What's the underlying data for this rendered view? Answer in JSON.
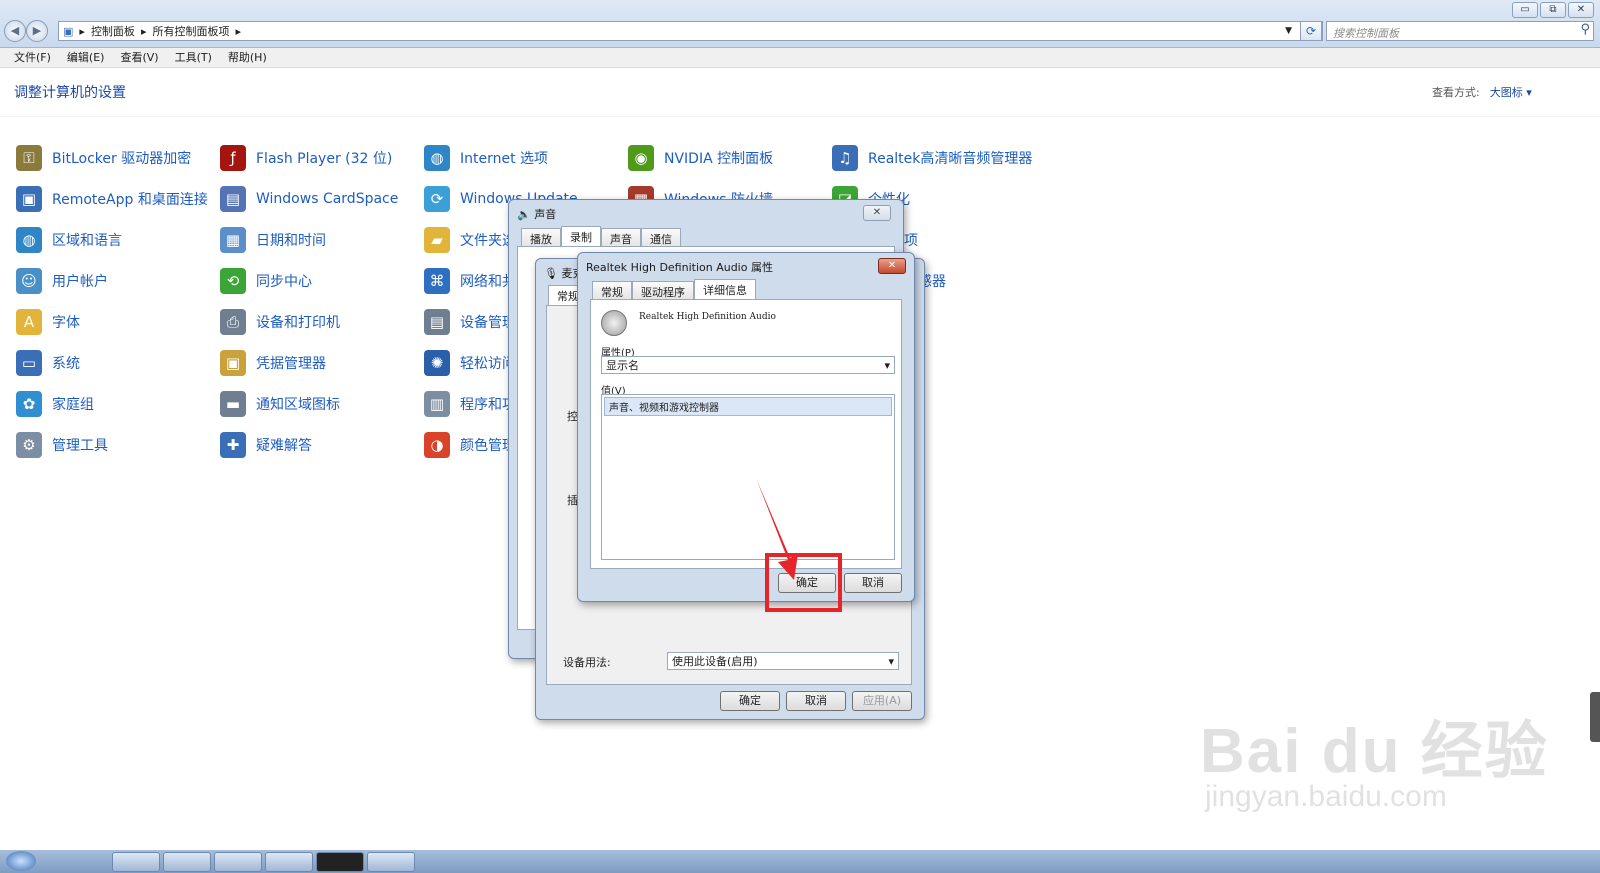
{
  "window": {
    "min": "▭",
    "max": "⧉",
    "close": "✕"
  },
  "address": {
    "crumbs": [
      "控制面板",
      "所有控制面板项"
    ],
    "search_placeholder": "搜索控制面板"
  },
  "menu": [
    "文件(F)",
    "编辑(E)",
    "查看(V)",
    "工具(T)",
    "帮助(H)"
  ],
  "header": {
    "title": "调整计算机的设置",
    "view_label": "查看方式:",
    "view_value": "大图标 ▾"
  },
  "items": {
    "col1": [
      {
        "label": "BitLocker 驱动器加密",
        "icon": "key-icon",
        "color": "#8a7a3c"
      },
      {
        "label": "RemoteApp 和桌面连接",
        "icon": "remote-desktop-icon",
        "color": "#3a6fb8"
      },
      {
        "label": "区域和语言",
        "icon": "globe-icon",
        "color": "#2e86c7"
      },
      {
        "label": "用户帐户",
        "icon": "users-icon",
        "color": "#4a90c8"
      },
      {
        "label": "字体",
        "icon": "font-icon",
        "color": "#e2b43a"
      },
      {
        "label": "系统",
        "icon": "computer-icon",
        "color": "#3a6fb8"
      },
      {
        "label": "家庭组",
        "icon": "homegroup-icon",
        "color": "#2f8fd0"
      },
      {
        "label": "管理工具",
        "icon": "tools-icon",
        "color": "#7b8ea3"
      }
    ],
    "col2": [
      {
        "label": "Flash Player (32 位)",
        "icon": "flash-icon",
        "color": "#a3150e"
      },
      {
        "label": "Windows CardSpace",
        "icon": "cardspace-icon",
        "color": "#5673b4"
      },
      {
        "label": "日期和时间",
        "icon": "calendar-icon",
        "color": "#5c8fc9"
      },
      {
        "label": "同步中心",
        "icon": "sync-icon",
        "color": "#3ca537"
      },
      {
        "label": "设备和打印机",
        "icon": "printer-icon",
        "color": "#6f7f91"
      },
      {
        "label": "凭据管理器",
        "icon": "vault-icon",
        "color": "#c9a23e"
      },
      {
        "label": "通知区域图标",
        "icon": "tray-icon",
        "color": "#6f7f91"
      },
      {
        "label": "疑难解答",
        "icon": "troubleshoot-icon",
        "color": "#3a6fb8"
      }
    ],
    "col3": [
      {
        "label": "Internet 选项",
        "icon": "internet-icon",
        "color": "#2e86c7"
      },
      {
        "label": "Windows Update",
        "icon": "update-icon",
        "color": "#3ca0d8"
      },
      {
        "label": "文件夹选",
        "icon": "folder-icon",
        "color": "#e2b43a"
      },
      {
        "label": "网络和共",
        "icon": "network-icon",
        "color": "#2e6fc0"
      },
      {
        "label": "设备管理",
        "icon": "device-manager-icon",
        "color": "#6f7f91"
      },
      {
        "label": "轻松访问",
        "icon": "accessibility-icon",
        "color": "#2a5faa"
      },
      {
        "label": "程序和功",
        "icon": "programs-icon",
        "color": "#7b8ea3"
      },
      {
        "label": "颜色管理",
        "icon": "color-icon",
        "color": "#d9432a"
      }
    ],
    "col4": [
      {
        "label": "NVIDIA 控制面板",
        "icon": "nvidia-icon",
        "color": "#4f9a1a"
      },
      {
        "label": "Windows 防火墙",
        "icon": "firewall-icon",
        "color": "#a33a2a"
      }
    ],
    "col5": [
      {
        "label": "Realtek高清晰音频管理器",
        "icon": "audio-manager-icon",
        "color": "#3a6fb8"
      },
      {
        "label": "个性化",
        "icon": "personalize-icon",
        "color": "#3ca537"
      },
      {
        "label": "选项"
      },
      {
        "label": "也传感器"
      }
    ]
  },
  "sound_dialog": {
    "title": "声音",
    "tabs": [
      "播放",
      "录制",
      "声音",
      "通信"
    ]
  },
  "mic_dialog": {
    "title": "麦克",
    "tab": "常规",
    "ctrl_label": "控",
    "plug_label": "插",
    "usage_label": "设备用法:",
    "usage_value": "使用此设备(启用)",
    "ok": "确定",
    "cancel": "取消",
    "apply": "应用(A)"
  },
  "props_dialog": {
    "title": "Realtek High Definition Audio 属性",
    "tabs": [
      "常规",
      "驱动程序",
      "详细信息"
    ],
    "device_name": "Realtek High Definition Audio",
    "prop_label": "属性(P)",
    "prop_value": "显示名",
    "value_label": "值(V)",
    "value_item": "声音、视频和游戏控制器",
    "ok": "确定",
    "cancel": "取消"
  },
  "watermark": {
    "line1": "Bai du 经验",
    "line2": "jingyan.baidu.com"
  },
  "colors": {
    "link": "#1e5dbf",
    "annotation": "#e5252a"
  }
}
